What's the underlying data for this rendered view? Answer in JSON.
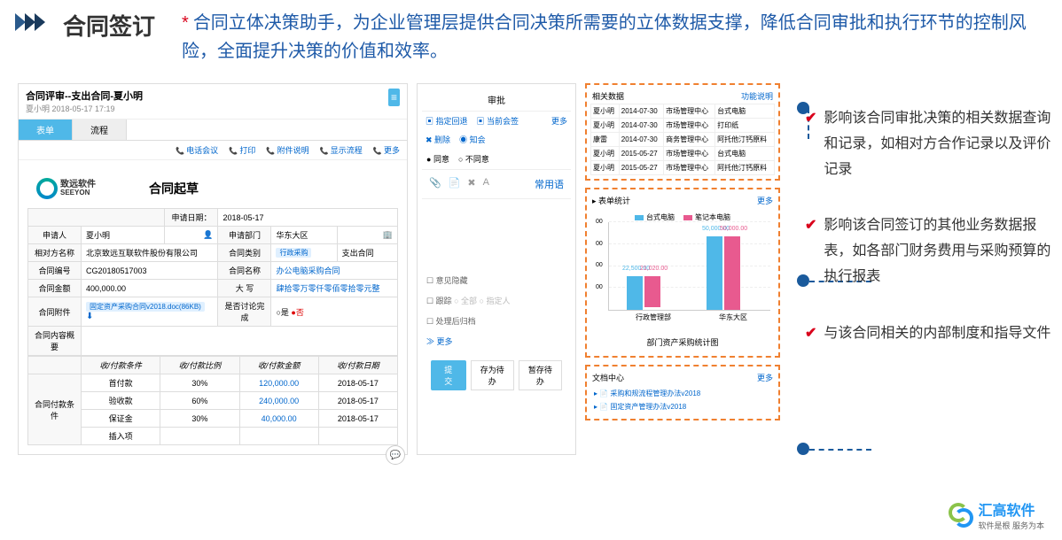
{
  "header": {
    "title": "合同签订",
    "subtitle_prefix": "*",
    "subtitle": "合同立体决策助手，为企业管理层提供合同决策所需要的立体数据支撑，降低合同审批和执行环节的控制风险，全面提升决策的价值和效率。"
  },
  "review_panel": {
    "title": "合同评审--支出合同-夏小明",
    "timestamp": "夏小明   2018-05-17 17:19",
    "tabs": [
      "表单",
      "流程"
    ],
    "toolbar": [
      "电话会议",
      "打印",
      "附件说明",
      "显示流程",
      "更多"
    ],
    "logo_name": "致远软件",
    "logo_en": "SEEYON",
    "form_title": "合同起草",
    "fields": {
      "apply_date_label": "申请日期：",
      "apply_date": "2018-05-17",
      "applicant_label": "申请人",
      "applicant": "夏小明",
      "apply_dept_label": "申请部门",
      "apply_dept": "华东大区",
      "party_label": "相对方名称",
      "party": "北京致远互联软件股份有限公司",
      "type_label": "合同类别",
      "type1": "行政采购",
      "type2": "支出合同",
      "no_label": "合同编号",
      "no": "CG20180517003",
      "name_label": "合同名称",
      "name": "办公电脑采购合同",
      "amount_label": "合同金额",
      "amount": "400,000.00",
      "caps_label": "大   写",
      "caps": "肆拾零万零仟零佰零拾零元整",
      "attach_label": "合同附件",
      "attach_file": "固定资产采购合同v2018.doc(86KB)",
      "discuss_label": "是否讨论完成",
      "summary_label": "合同内容概要",
      "pay_label": "合同付款条件"
    },
    "pay_headers": [
      "收/付款条件",
      "收/付款比例",
      "收/付款金额",
      "收/付款日期"
    ],
    "pay_rows": [
      {
        "cond": "首付款",
        "ratio": "30%",
        "amt": "120,000.00",
        "date": "2018-05-17"
      },
      {
        "cond": "验收款",
        "ratio": "60%",
        "amt": "240,000.00",
        "date": "2018-05-17"
      },
      {
        "cond": "保证金",
        "ratio": "30%",
        "amt": "40,000.00",
        "date": "2018-05-17"
      },
      {
        "cond": "插入项",
        "ratio": "",
        "amt": "",
        "date": ""
      }
    ]
  },
  "approval": {
    "title": "审批",
    "row1": [
      "指定回退",
      "当前会签",
      "更多"
    ],
    "row2": [
      "删除",
      "知会"
    ],
    "agree": "同意",
    "disagree": "不同意",
    "common": "常用语",
    "opinion_hide": "意见隐藏",
    "track": "跟踪",
    "track_opts": [
      "全部",
      "指定人"
    ],
    "archive": "处理后归档",
    "btn_submit": "提交",
    "btn_save": "存为待办",
    "btn_pause": "暂存待办"
  },
  "related": {
    "title": "相关数据",
    "func": "功能说明",
    "rows": [
      [
        "夏小明",
        "2014-07-30",
        "市场管理中心",
        "台式电脑"
      ],
      [
        "夏小明",
        "2014-07-30",
        "市场管理中心",
        "打印纸"
      ],
      [
        "康雷",
        "2014-07-30",
        "商务管理中心",
        "阿托他汀钙原料"
      ],
      [
        "夏小明",
        "2015-05-27",
        "市场管理中心",
        "台式电脑"
      ],
      [
        "夏小明",
        "2015-05-27",
        "市场管理中心",
        "阿托他汀钙原料"
      ]
    ]
  },
  "chart_data": {
    "type": "bar",
    "title": "部门资产采购统计图",
    "stat_label": "表单统计",
    "more": "更多",
    "legend": [
      "台式电脑",
      "笔记本电脑"
    ],
    "categories": [
      "行政管理部",
      "华东大区"
    ],
    "series": [
      {
        "name": "台式电脑",
        "values": [
          22500.0,
          50000.0
        ],
        "color": "#4fb8e8"
      },
      {
        "name": "笔记本电脑",
        "values": [
          21020.0,
          50000.0
        ],
        "color": "#e85a8f"
      }
    ],
    "ylim": [
      0,
      60000
    ],
    "yticks": [
      "00",
      "00",
      "00",
      "00"
    ]
  },
  "docs": {
    "title": "文档中心",
    "more": "更多",
    "items": [
      "采购和规流程管理办法v2018",
      "固定资产管理办法v2018"
    ]
  },
  "annotations": [
    "影响该合同审批决策的相关数据查询和记录，如相对方合作记录以及评价记录",
    "影响该合同签订的其他业务数据报表，如各部门财务费用与采购预算的执行报表",
    "与该合同相关的内部制度和指导文件"
  ],
  "footer": {
    "brand": "汇高软件",
    "slogan": "软件是根 服务为本"
  }
}
